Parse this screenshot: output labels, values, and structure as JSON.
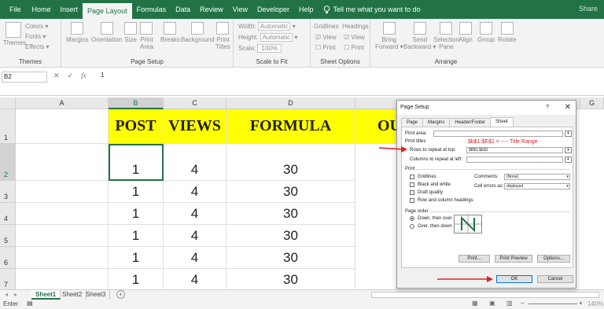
{
  "ribbon_tabs": [
    "File",
    "Home",
    "Insert",
    "Page Layout",
    "Formulas",
    "Data",
    "Review",
    "View",
    "Developer",
    "Help"
  ],
  "tell_me": "Tell me what you want to do",
  "share": "Share",
  "ribbon": {
    "themes": {
      "themes": "Themes",
      "colors": "Colors",
      "fonts": "Fonts",
      "effects": "Effects",
      "label": "Themes"
    },
    "page_setup": {
      "margins": "Margins",
      "orientation": "Orientation",
      "size": "Size",
      "print_area_1": "Print",
      "print_area_2": "Area",
      "breaks": "Breaks",
      "background": "Background",
      "print_titles_1": "Print",
      "print_titles_2": "Titles",
      "label": "Page Setup"
    },
    "scale": {
      "width": "Width:",
      "width_val": "Automatic",
      "height": "Height:",
      "height_val": "Automatic",
      "scale": "Scale:",
      "scale_val": "100%",
      "label": "Scale to Fit"
    },
    "sheet_options": {
      "gridlines": "Gridlines",
      "headings": "Headings",
      "view": "View",
      "print": "Print",
      "label": "Sheet Options"
    },
    "arrange": {
      "bring_1": "Bring",
      "bring_2": "Forward",
      "send_1": "Send",
      "send_2": "Backward",
      "selection_1": "Selection",
      "selection_2": "Pane",
      "align": "Align",
      "group": "Group",
      "rotate": "Rotate",
      "label": "Arrange"
    }
  },
  "formula_bar": {
    "name_box": "B2",
    "cancel": "✕",
    "enter": "✓",
    "fx": "fx",
    "value": "1"
  },
  "columns": [
    "A",
    "B",
    "C",
    "D",
    "G"
  ],
  "rows": [
    "1",
    "2",
    "3",
    "4",
    "5",
    "6",
    "7"
  ],
  "headers": {
    "b": "POST",
    "c": "VIEWS",
    "d": "FORMULA",
    "e": "OU"
  },
  "data_rows": [
    {
      "post": "1",
      "views": "4",
      "formula": "30"
    },
    {
      "post": "1",
      "views": "4",
      "formula": "30"
    },
    {
      "post": "1",
      "views": "4",
      "formula": "30"
    },
    {
      "post": "1",
      "views": "4",
      "formula": "30"
    },
    {
      "post": "1",
      "views": "4",
      "formula": "30"
    },
    {
      "post": "1",
      "views": "4",
      "formula": "30"
    }
  ],
  "sheets": [
    "Sheet1",
    "Sheet2",
    "Sheet3"
  ],
  "status": {
    "mode": "Enter",
    "zoom": "140%"
  },
  "dialog": {
    "title": "Page Setup",
    "help": "?",
    "close": "✕",
    "tabs": [
      "Page",
      "Margins",
      "Header/Footer",
      "Sheet"
    ],
    "print_area_label": "Print area:",
    "print_titles_label": "Print titles",
    "annotation": "$b$1:$E$1 < ---- Title Range",
    "rows_repeat_label": "Rows to repeat at top:",
    "rows_repeat_value": "$B$1:$E$1",
    "cols_repeat_label": "Columns to repeat at left:",
    "print_label": "Print",
    "gridlines": "Gridlines",
    "black_white": "Black and white",
    "draft": "Draft quality",
    "row_col_headings": "Row and column headings",
    "comments_label": "Comments:",
    "comments_value": "(None)",
    "errors_label": "Cell errors as:",
    "errors_value": "displayed",
    "page_order_label": "Page order",
    "down_over": "Down, then over",
    "over_down": "Over, then down",
    "print_btn": "Print...",
    "preview_btn": "Print Preview",
    "options_btn": "Options...",
    "ok_btn": "OK",
    "cancel_btn": "Cancel"
  },
  "colors": {
    "excel_green": "#217346",
    "highlight": "#ffff00",
    "annotation_red": "#e02020"
  }
}
